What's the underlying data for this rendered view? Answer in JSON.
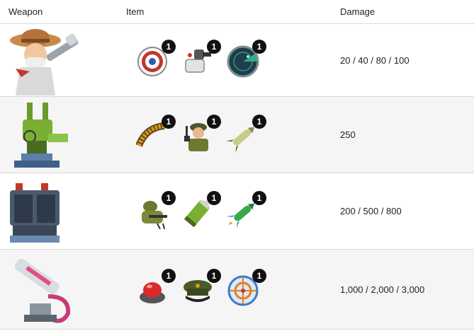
{
  "headers": {
    "weapon": "Weapon",
    "item": "Item",
    "damage": "Damage"
  },
  "rows": [
    {
      "weapon_icon": "bazooka-soldier-icon",
      "items": [
        {
          "icon": "target-icon",
          "count": "1"
        },
        {
          "icon": "telescope-icon",
          "count": "1"
        },
        {
          "icon": "radar-icon",
          "count": "1"
        }
      ],
      "damage": "20 / 40 / 80 / 100"
    },
    {
      "weapon_icon": "anti-air-turret-icon",
      "items": [
        {
          "icon": "ammo-belt-icon",
          "count": "1"
        },
        {
          "icon": "radio-soldier-icon",
          "count": "1"
        },
        {
          "icon": "missile-icon",
          "count": "1"
        }
      ],
      "damage": "250"
    },
    {
      "weapon_icon": "rocket-launcher-icon",
      "items": [
        {
          "icon": "sniper-soldier-icon",
          "count": "1"
        },
        {
          "icon": "shell-icon",
          "count": "1"
        },
        {
          "icon": "green-rocket-icon",
          "count": "1"
        }
      ],
      "damage": "200 / 500 / 800"
    },
    {
      "weapon_icon": "laser-cannon-icon",
      "items": [
        {
          "icon": "red-button-icon",
          "count": "1"
        },
        {
          "icon": "officer-cap-icon",
          "count": "1"
        },
        {
          "icon": "crosshair-icon",
          "count": "1"
        }
      ],
      "damage": "1,000 / 2,000 / 3,000"
    }
  ]
}
